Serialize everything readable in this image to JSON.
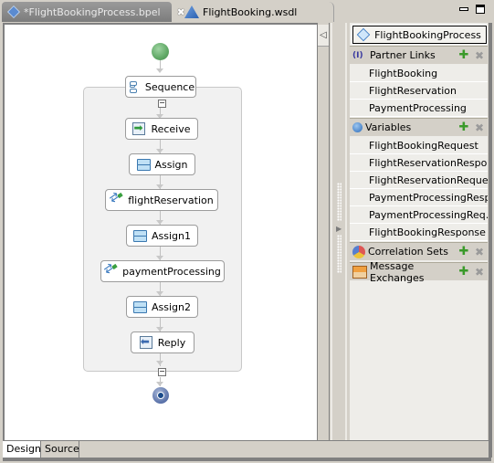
{
  "editor": {
    "tabs": [
      {
        "label": "*FlightBookingProcess.bpel",
        "icon": "bpel-process-icon",
        "active": true,
        "closable": true
      },
      {
        "label": "FlightBooking.wsdl",
        "icon": "wsdl-icon",
        "active": false
      }
    ],
    "window_controls": {
      "minimize": "minimize-icon",
      "maximize": "maximize-icon"
    }
  },
  "diagram": {
    "start_node": "start",
    "sequence": {
      "label": "Sequence",
      "icon": "sequence-icon"
    },
    "activities": [
      {
        "label": "Receive",
        "icon": "receive-icon"
      },
      {
        "label": "Assign",
        "icon": "assign-icon"
      },
      {
        "label": "flightReservation",
        "icon": "invoke-icon"
      },
      {
        "label": "Assign1",
        "icon": "assign-icon"
      },
      {
        "label": "paymentProcessing",
        "icon": "invoke-icon"
      },
      {
        "label": "Assign2",
        "icon": "assign-icon"
      },
      {
        "label": "Reply",
        "icon": "reply-icon"
      }
    ],
    "end_node": "end",
    "collapse_glyph": "−"
  },
  "palette": {
    "toggle_glyph": "◁"
  },
  "sash": {
    "arrow_glyph": "▶"
  },
  "tray": {
    "process_label": "FlightBookingProcess",
    "sections": {
      "partner_links": {
        "label": "Partner Links",
        "items": [
          "FlightBooking",
          "FlightReservation",
          "PaymentProcessing"
        ]
      },
      "variables": {
        "label": "Variables",
        "items": [
          "FlightBookingRequest",
          "FlightReservationRespo…",
          "FlightReservationRequest",
          "PaymentProcessingResp…",
          "PaymentProcessingReq…",
          "FlightBookingResponse"
        ]
      },
      "correlation_sets": {
        "label": "Correlation Sets"
      },
      "message_exchanges": {
        "label": "Message Exchanges"
      }
    },
    "add_glyph": "✚",
    "delete_glyph": "✖"
  },
  "bottom_tabs": [
    {
      "label": "Design",
      "active": true
    },
    {
      "label": "Source",
      "active": false
    }
  ],
  "colors": {
    "start_green": "#5fa865",
    "end_blue": "#1a4a8a",
    "add_green": "#3a9a2a",
    "chrome_gray": "#d4d0c8"
  }
}
